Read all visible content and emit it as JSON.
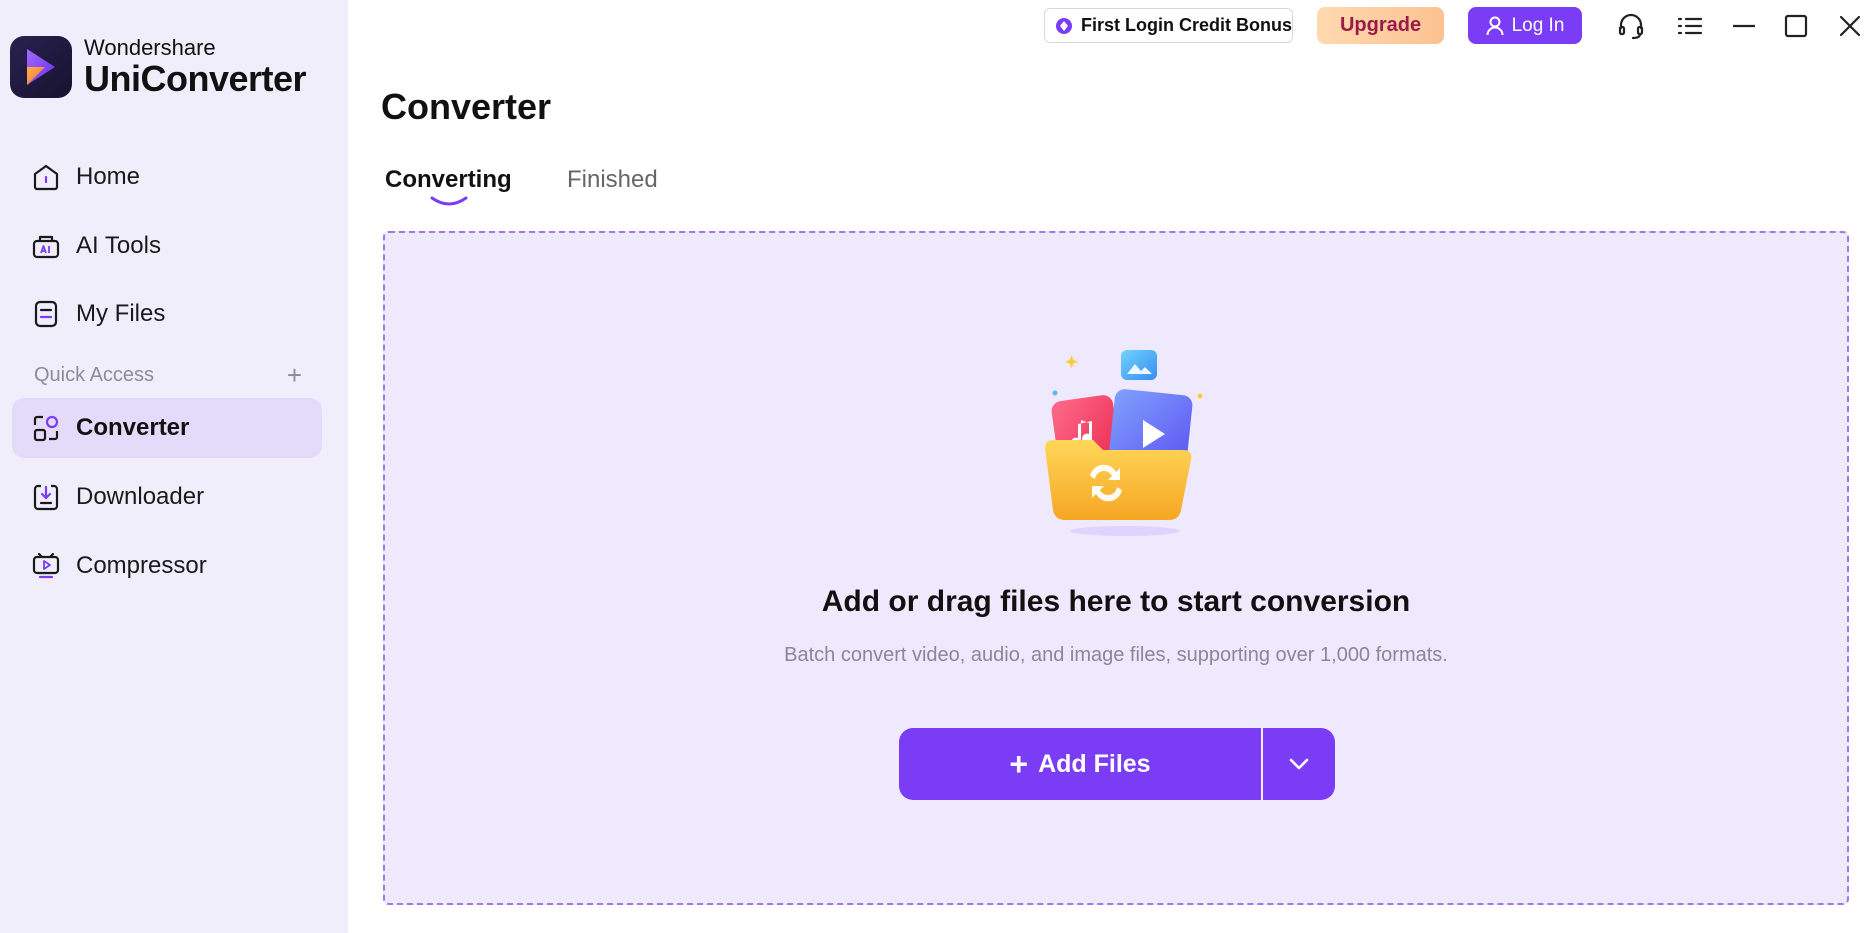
{
  "brand": {
    "company": "Wondershare",
    "product": "UniConverter"
  },
  "sidebar": {
    "items": [
      {
        "label": "Home",
        "icon": "home-icon"
      },
      {
        "label": "AI Tools",
        "icon": "ai-tools-icon"
      },
      {
        "label": "My Files",
        "icon": "my-files-icon"
      }
    ],
    "quick_access_label": "Quick Access",
    "quick_items": [
      {
        "label": "Converter",
        "icon": "converter-icon",
        "active": true
      },
      {
        "label": "Downloader",
        "icon": "downloader-icon"
      },
      {
        "label": "Compressor",
        "icon": "compressor-icon"
      }
    ]
  },
  "topbar": {
    "bonus_label": "First Login Credit Bonus",
    "upgrade_label": "Upgrade",
    "login_label": "Log In"
  },
  "main": {
    "title": "Converter",
    "tabs": [
      {
        "label": "Converting",
        "active": true
      },
      {
        "label": "Finished",
        "active": false
      }
    ],
    "dropzone": {
      "title": "Add or drag files here to start conversion",
      "subtitle": "Batch convert video, audio, and image files, supporting over 1,000 formats.",
      "add_files_label": "Add Files"
    }
  },
  "colors": {
    "accent": "#7b3cf5",
    "sidebar_bg": "#f1eefb",
    "active_item_bg": "#e4dbfa",
    "dropzone_bg": "#efe9fd",
    "upgrade_text": "#9a1a4a"
  }
}
